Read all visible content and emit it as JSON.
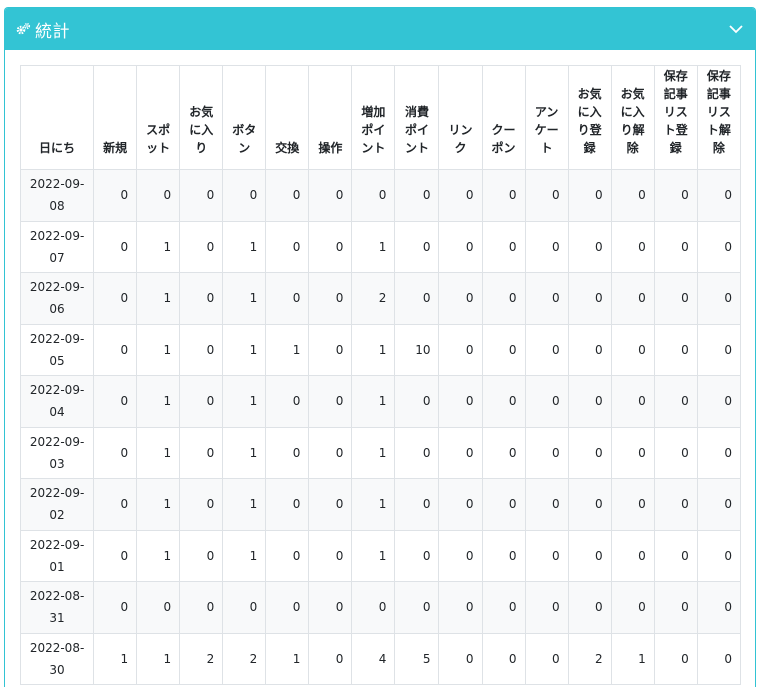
{
  "header": {
    "title": "統計",
    "icon": "gears-icon",
    "toggle_icon": "chevron-down-icon"
  },
  "colors": {
    "header_bg": "#33c4d4",
    "header_text": "#ffffff",
    "border": "#dee2e6"
  },
  "table": {
    "columns": [
      "日にち",
      "新規",
      "スポット",
      "お気に入り",
      "ボタン",
      "交換",
      "操作",
      "増加ポイント",
      "消費ポイント",
      "リンク",
      "クーポン",
      "アンケート",
      "お気に入り登録",
      "お気に入り解除",
      "保存記事リスト登録",
      "保存記事リスト解除"
    ],
    "rows": [
      [
        "2022-09-08",
        "0",
        "0",
        "0",
        "0",
        "0",
        "0",
        "0",
        "0",
        "0",
        "0",
        "0",
        "0",
        "0",
        "0",
        "0"
      ],
      [
        "2022-09-07",
        "0",
        "1",
        "0",
        "1",
        "0",
        "0",
        "1",
        "0",
        "0",
        "0",
        "0",
        "0",
        "0",
        "0",
        "0"
      ],
      [
        "2022-09-06",
        "0",
        "1",
        "0",
        "1",
        "0",
        "0",
        "2",
        "0",
        "0",
        "0",
        "0",
        "0",
        "0",
        "0",
        "0"
      ],
      [
        "2022-09-05",
        "0",
        "1",
        "0",
        "1",
        "1",
        "0",
        "1",
        "10",
        "0",
        "0",
        "0",
        "0",
        "0",
        "0",
        "0"
      ],
      [
        "2022-09-04",
        "0",
        "1",
        "0",
        "1",
        "0",
        "0",
        "1",
        "0",
        "0",
        "0",
        "0",
        "0",
        "0",
        "0",
        "0"
      ],
      [
        "2022-09-03",
        "0",
        "1",
        "0",
        "1",
        "0",
        "0",
        "1",
        "0",
        "0",
        "0",
        "0",
        "0",
        "0",
        "0",
        "0"
      ],
      [
        "2022-09-02",
        "0",
        "1",
        "0",
        "1",
        "0",
        "0",
        "1",
        "0",
        "0",
        "0",
        "0",
        "0",
        "0",
        "0",
        "0"
      ],
      [
        "2022-09-01",
        "0",
        "1",
        "0",
        "1",
        "0",
        "0",
        "1",
        "0",
        "0",
        "0",
        "0",
        "0",
        "0",
        "0",
        "0"
      ],
      [
        "2022-08-31",
        "0",
        "0",
        "0",
        "0",
        "0",
        "0",
        "0",
        "0",
        "0",
        "0",
        "0",
        "0",
        "0",
        "0",
        "0"
      ],
      [
        "2022-08-30",
        "1",
        "1",
        "2",
        "2",
        "1",
        "0",
        "4",
        "5",
        "0",
        "0",
        "0",
        "2",
        "1",
        "0",
        "0"
      ]
    ]
  }
}
